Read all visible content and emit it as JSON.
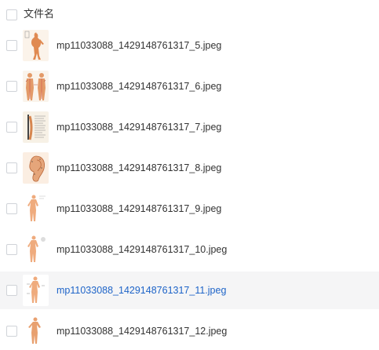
{
  "header": {
    "column_title": "文件名"
  },
  "files": [
    {
      "name": "mp11033088_1429148761317_5.jpeg",
      "thumb": "figure-thumbnail"
    },
    {
      "name": "mp11033088_1429148761317_6.jpeg",
      "thumb": "meridian-chart-thumbnail"
    },
    {
      "name": "mp11033088_1429148761317_7.jpeg",
      "thumb": "spine-chart-thumbnail"
    },
    {
      "name": "mp11033088_1429148761317_8.jpeg",
      "thumb": "ear-chart-thumbnail"
    },
    {
      "name": "mp11033088_1429148761317_9.jpeg",
      "thumb": "figure-thumbnail"
    },
    {
      "name": "mp11033088_1429148761317_10.jpeg",
      "thumb": "figure-thumbnail"
    },
    {
      "name": "mp11033088_1429148761317_11.jpeg",
      "thumb": "figure-thumbnail",
      "hovered": true
    },
    {
      "name": "mp11033088_1429148761317_12.jpeg",
      "thumb": "figure-thumbnail"
    }
  ],
  "colors": {
    "link_hover": "#1e64c8",
    "row_hover_bg": "#f5f5f6",
    "text": "#333333"
  }
}
